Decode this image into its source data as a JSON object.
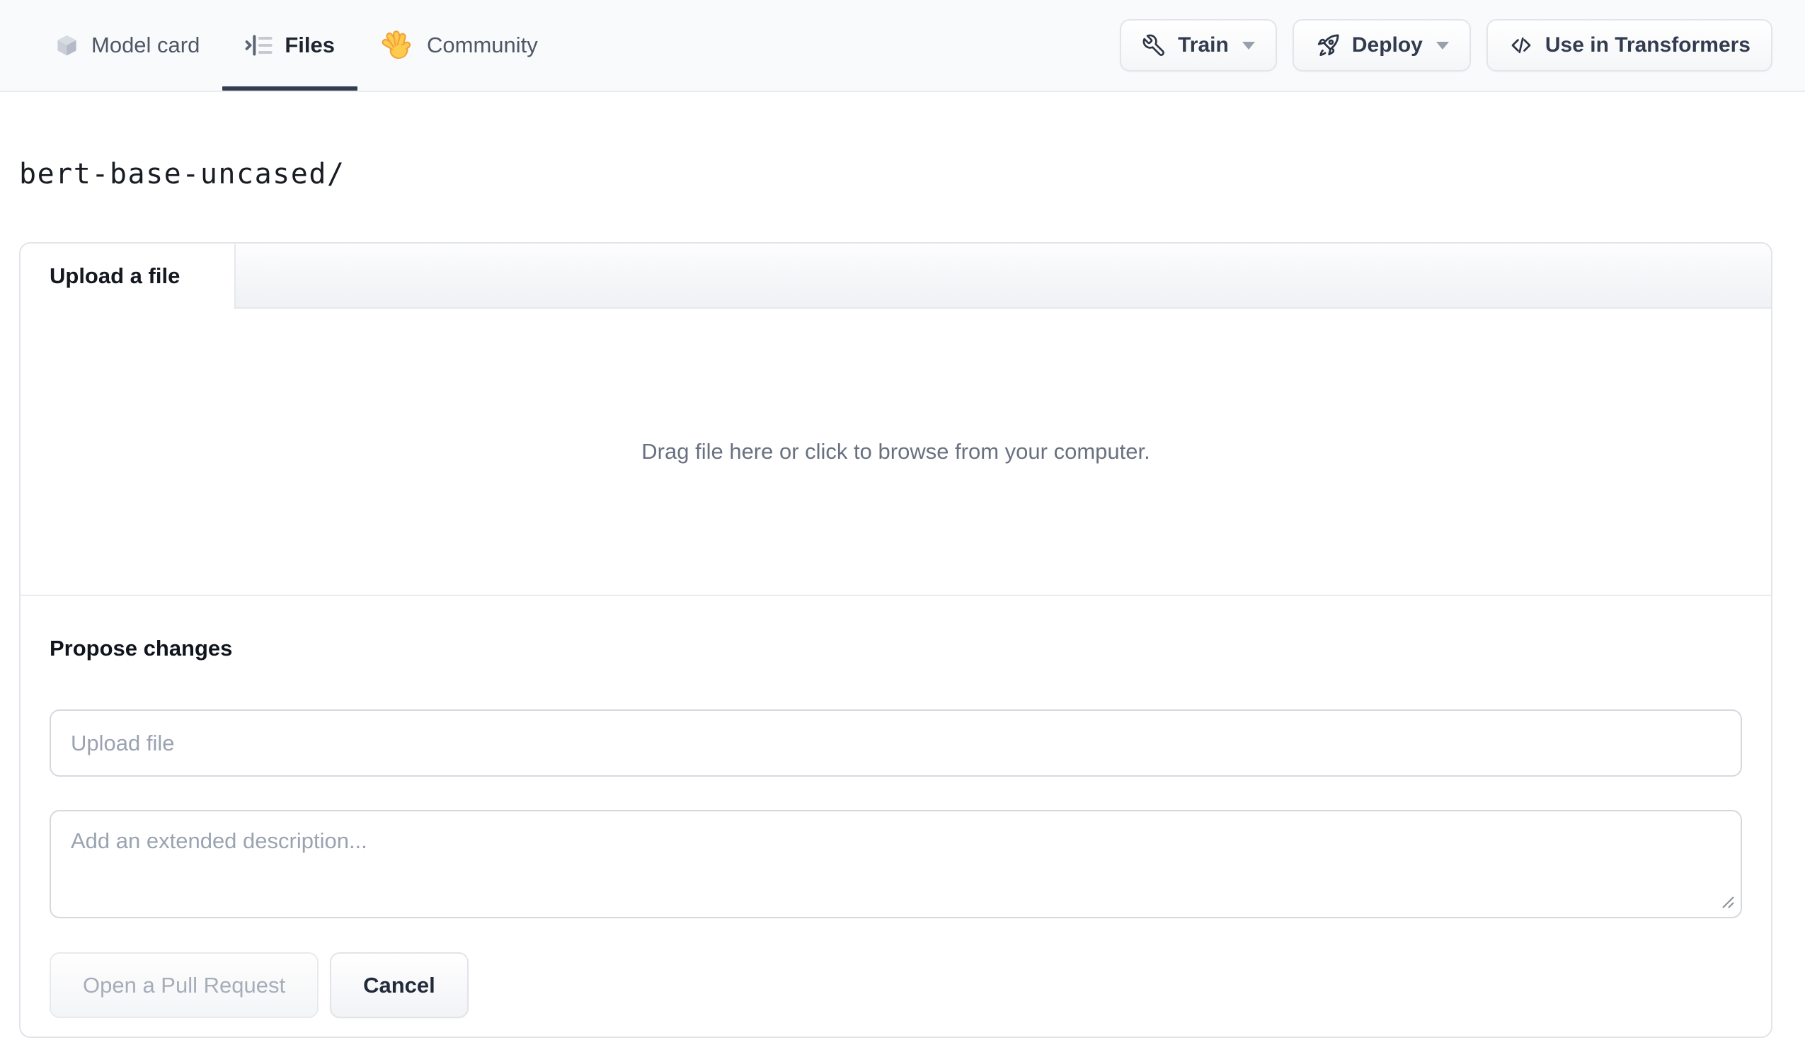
{
  "header": {
    "tabs": [
      {
        "label": "Model card",
        "icon": "cube-icon",
        "active": false
      },
      {
        "label": "Files",
        "icon": "files-list-icon",
        "active": true
      },
      {
        "label": "Community",
        "icon": "waving-hand-icon",
        "active": false
      }
    ],
    "actions": [
      {
        "label": "Train",
        "icon": "wrench-icon",
        "has_dropdown": true
      },
      {
        "label": "Deploy",
        "icon": "rocket-icon",
        "has_dropdown": true
      },
      {
        "label": "Use in Transformers",
        "icon": "code-icon",
        "has_dropdown": false
      }
    ]
  },
  "breadcrumb": {
    "repo_path": "bert-base-uncased/"
  },
  "upload_card": {
    "tab_label": "Upload a file",
    "dropzone_text": "Drag file here or click to browse from your computer.",
    "propose": {
      "heading": "Propose changes",
      "filename_placeholder": "Upload file",
      "description_placeholder": "Add an extended description...",
      "submit_label": "Open a Pull Request",
      "cancel_label": "Cancel"
    }
  },
  "colors": {
    "active_tab_underline": "#353e50",
    "nav_background": "#f9fafb",
    "card_border": "#e2e4e9",
    "input_border": "#d5d9df",
    "placeholder_text": "#9aa3b1",
    "disabled_button_text": "#a6adba",
    "muted_text": "#697180",
    "emoji_yellow": "#ffcb4c"
  }
}
